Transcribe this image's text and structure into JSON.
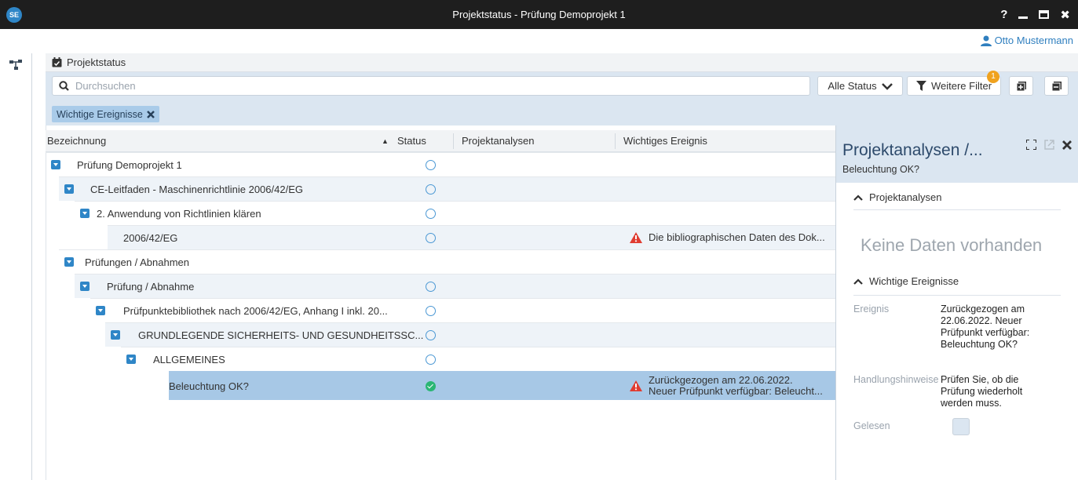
{
  "window": {
    "logo": "SE",
    "title": "Projektstatus - Prüfung Demoprojekt 1",
    "controls": [
      "help-icon",
      "minimize-icon",
      "maximize-icon",
      "close-icon"
    ],
    "help_label": "?",
    "close_label": "✖"
  },
  "user": {
    "name": "Otto Mustermann",
    "icon": "user-icon"
  },
  "nav": {
    "icon": "tree-icon"
  },
  "section": {
    "title": "Projektstatus",
    "icon": "calendar-check-icon"
  },
  "toolbar": {
    "search_placeholder": "Durchsuchen",
    "status_filter": "Alle Status",
    "more_filters": "Weitere Filter",
    "filter_badge": "1",
    "chip_label": "Wichtige Ereignisse"
  },
  "grid": {
    "columns": [
      "Bezeichnung",
      "Status",
      "Projektanalysen",
      "Wichtiges Ereignis"
    ],
    "sort_indicator": "▲",
    "rows": [
      {
        "label": "Prüfung Demoprojekt 1",
        "status": "open",
        "event": ""
      },
      {
        "label": "CE-Leitfaden - Maschinenrichtlinie 2006/42/EG",
        "status": "open",
        "event": ""
      },
      {
        "label": "2. Anwendung von Richtlinien klären",
        "status": "open",
        "event": ""
      },
      {
        "label": "2006/42/EG",
        "status": "open",
        "event": "Die bibliographischen Daten des Dok..."
      },
      {
        "label": "Prüfungen / Abnahmen",
        "status": "",
        "event": ""
      },
      {
        "label": "Prüfung / Abnahme",
        "status": "open",
        "event": ""
      },
      {
        "label": "Prüfpunktebibliothek nach 2006/42/EG, Anhang I  inkl. 20...",
        "status": "open",
        "event": ""
      },
      {
        "label": "GRUNDLEGENDE SICHERHEITS- UND GESUNDHEITSSC...",
        "status": "open",
        "event": ""
      },
      {
        "label": "ALLGEMEINES",
        "status": "open",
        "event": ""
      },
      {
        "label": "Beleuchtung OK?",
        "status": "done",
        "event": "Zurückgezogen am 22.06.2022.",
        "event_line2": "Neuer Prüfpunkt verfügbar: Beleucht..."
      }
    ]
  },
  "panel": {
    "title": "Projektanalysen /...",
    "subtitle": "Beleuchtung OK?",
    "section1": "Projektanalysen",
    "empty_text": "Keine Daten vorhanden",
    "section2": "Wichtige Ereignisse",
    "fields": [
      {
        "key": "Ereignis",
        "value": "Zurückgezogen am 22.06.2022. Neuer Prüfpunkt verfügbar: Beleuchtung OK?"
      },
      {
        "key": "Handlungshinweise",
        "value": "Prüfen Sie, ob die Prüfung wiederholt werden muss."
      },
      {
        "key": "Gelesen",
        "value": ""
      }
    ]
  },
  "colors": {
    "titlebar": "#1e1e1e",
    "accent": "#2f86c7",
    "selected_row": "#a7c8e6",
    "warning": "#e03c31",
    "ok": "#2bb673",
    "badge": "#f0a21e"
  }
}
